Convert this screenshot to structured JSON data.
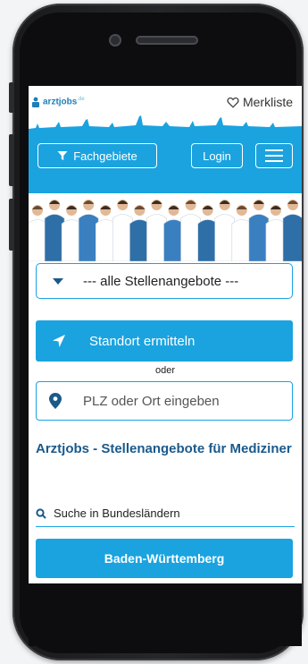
{
  "header": {
    "logo_text": "arztjobs",
    "logo_suffix": ".de",
    "merkliste_label": "Merkliste"
  },
  "nav": {
    "fachgebiete_label": "Fachgebiete",
    "login_label": "Login"
  },
  "search": {
    "category_select": "--- alle Stellenangebote ---",
    "locate_button_label": "Standort ermitteln",
    "or_label": "oder",
    "location_placeholder": "PLZ oder Ort eingeben"
  },
  "content": {
    "heading": "Arztjobs - Stellenangebote für Mediziner",
    "states_search_label": "Suche in Bundesländern",
    "first_state": "Baden-Württemberg"
  },
  "colors": {
    "accent": "#1aa3df",
    "heading": "#1a5a8c"
  },
  "icons": [
    "heart-icon",
    "filter-icon",
    "hamburger-menu-icon",
    "caret-down-icon",
    "location-arrow-icon",
    "map-pin-icon",
    "search-icon"
  ]
}
